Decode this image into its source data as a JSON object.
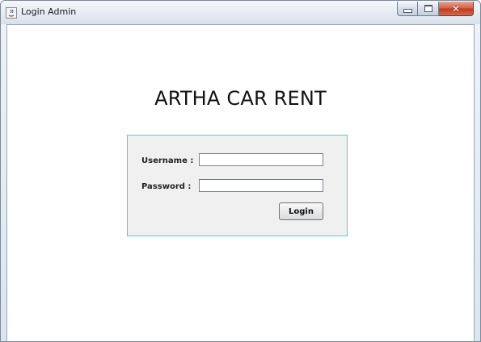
{
  "window": {
    "title": "Login Admin",
    "controls": {
      "minimize_icon": "minimize-icon",
      "maximize_icon": "maximize-icon",
      "close_glyph": "x"
    }
  },
  "main": {
    "heading": "ARTHA CAR RENT",
    "form": {
      "username_label": "Username :",
      "username_value": "",
      "password_label": "Password :",
      "password_value": "",
      "login_label": "Login"
    }
  },
  "colors": {
    "panel_border": "#5fc9cf",
    "panel_background": "#f0f0f1",
    "close_button": "#c23a1c"
  }
}
